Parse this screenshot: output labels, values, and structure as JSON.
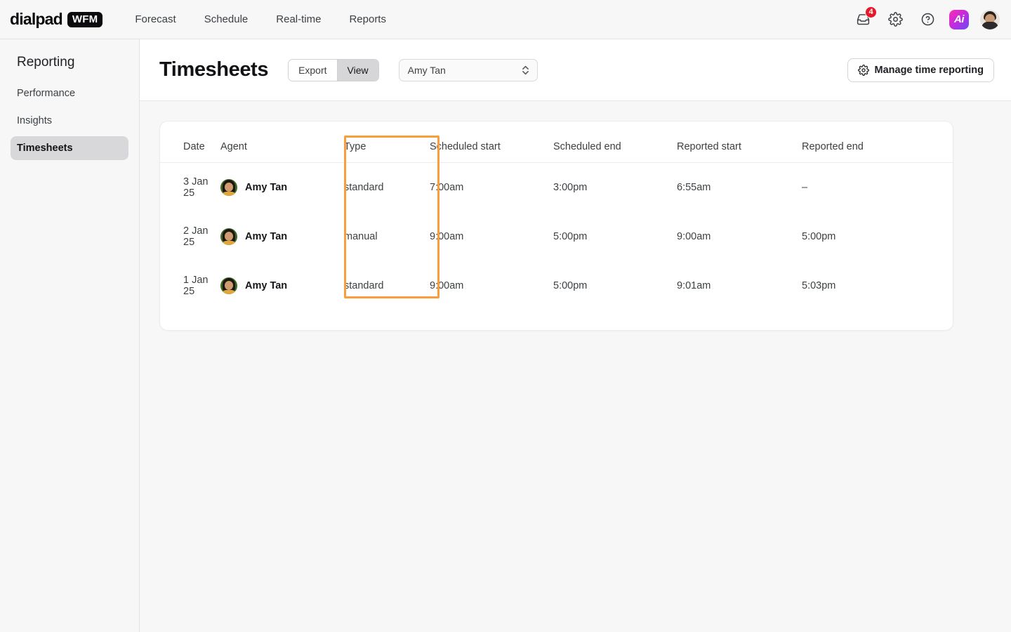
{
  "topnav": {
    "logo_word": "dialpad",
    "logo_badge": "WFM",
    "links": [
      {
        "label": "Forecast"
      },
      {
        "label": "Schedule"
      },
      {
        "label": "Real-time"
      },
      {
        "label": "Reports"
      }
    ],
    "inbox_badge_count": "4",
    "inbox_icon": "inbox-icon",
    "settings_icon": "gear-icon",
    "help_icon": "help-circle-icon",
    "ai_icon_label": "Ai",
    "avatar_label": "user-avatar"
  },
  "sidebar": {
    "title": "Reporting",
    "items": [
      {
        "label": "Performance",
        "active": false
      },
      {
        "label": "Insights",
        "active": false
      },
      {
        "label": "Timesheets",
        "active": true
      }
    ]
  },
  "header": {
    "title": "Timesheets",
    "segmented": [
      {
        "label": "Export",
        "active": false
      },
      {
        "label": "View",
        "active": true
      }
    ],
    "agent_select": {
      "value": "Amy Tan",
      "options": [
        "Amy Tan"
      ]
    },
    "manage_button": {
      "label": "Manage time reporting",
      "icon": "gear-icon"
    }
  },
  "table": {
    "columns": [
      "Date",
      "Agent",
      "Type",
      "Scheduled start",
      "Scheduled end",
      "Reported start",
      "Reported end"
    ],
    "rows": [
      {
        "date": "3 Jan 25",
        "agent": "Amy Tan",
        "type": "standard",
        "scheduled_start": "7:00am",
        "scheduled_end": "3:00pm",
        "reported_start": "6:55am",
        "reported_end": "–"
      },
      {
        "date": "2 Jan 25",
        "agent": "Amy Tan",
        "type": "manual",
        "scheduled_start": "9:00am",
        "scheduled_end": "5:00pm",
        "reported_start": "9:00am",
        "reported_end": "5:00pm"
      },
      {
        "date": "1 Jan 25",
        "agent": "Amy Tan",
        "type": "standard",
        "scheduled_start": "9:00am",
        "scheduled_end": "5:00pm",
        "reported_start": "9:01am",
        "reported_end": "5:03pm"
      }
    ]
  },
  "annotation": {
    "highlight_color": "#fa9e3b",
    "highlighted_column": "Type"
  }
}
